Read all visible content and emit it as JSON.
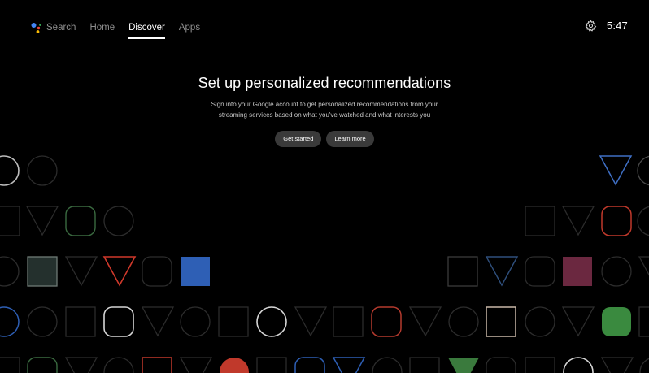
{
  "nav": {
    "items": [
      {
        "label": "Search",
        "active": false
      },
      {
        "label": "Home",
        "active": false
      },
      {
        "label": "Discover",
        "active": true
      },
      {
        "label": "Apps",
        "active": false
      }
    ]
  },
  "status": {
    "time": "5:47",
    "settings_icon": "gear-icon"
  },
  "hero": {
    "title": "Set up personalized recommendations",
    "body": "Sign into your Google account to get personalized recommendations from your streaming services based on what you've watched and what interests you",
    "primary_label": "Get started",
    "secondary_label": "Learn more"
  },
  "colors": {
    "background": "#000000",
    "pill_button": "#3a3a3a",
    "assistant_blue": "#4285f4",
    "assistant_red": "#ea4335",
    "assistant_yellow": "#fbbc05",
    "assistant_green": "#34a853"
  }
}
